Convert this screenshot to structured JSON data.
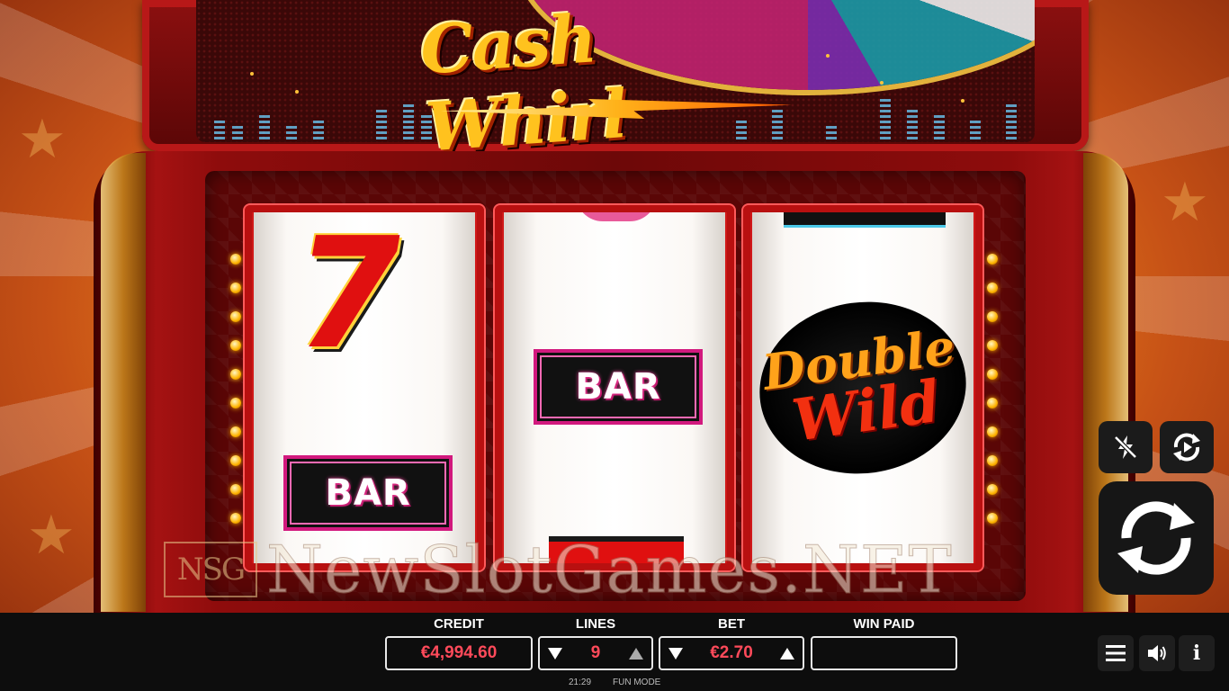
{
  "game": {
    "title": "Cash Whirl",
    "brand_color": "#ffc21e",
    "accent_color": "#ff4a5a"
  },
  "reels": [
    {
      "symbols": [
        "seven",
        "bar"
      ],
      "bar_label": "BAR",
      "seven_label": "7"
    },
    {
      "symbols": [
        "bar"
      ],
      "bar_label": "BAR"
    },
    {
      "symbols": [
        "double-wild"
      ],
      "wild_line1": "Double",
      "wild_line2": "Wild"
    }
  ],
  "watermark": {
    "logo": "NSG",
    "text": "NewSlotGames.NET"
  },
  "side_controls": {
    "turbo_icon": "lightning-off-icon",
    "autoplay_icon": "autoplay-icon",
    "spin_icon": "spin-arrows-icon"
  },
  "bottom_bar": {
    "credit_label": "CREDIT",
    "credit_value": "€4,994.60",
    "lines_label": "LINES",
    "lines_value": "9",
    "bet_label": "BET",
    "bet_value": "€2.70",
    "win_label": "WIN PAID",
    "win_value": ""
  },
  "status": {
    "time": "21:29",
    "mode": "FUN MODE"
  },
  "menu_controls": {
    "menu_icon": "menu-icon",
    "sound_icon": "speaker-icon",
    "info_icon": "info-icon",
    "info_label": "i"
  }
}
